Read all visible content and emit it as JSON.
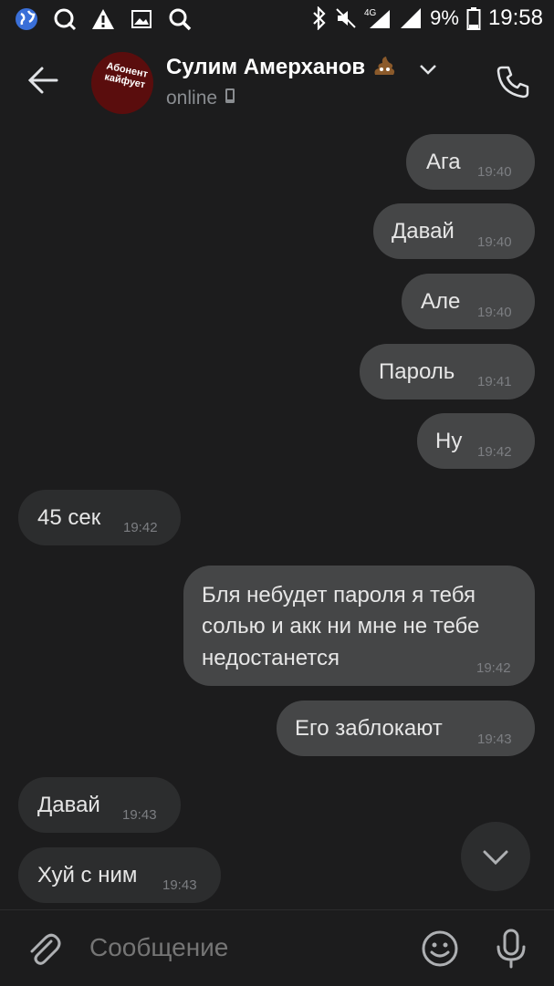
{
  "statusbar": {
    "network": "4G",
    "battery": "9%",
    "time": "19:58"
  },
  "header": {
    "contact_name": "Сулим Амерханов",
    "status": "online",
    "avatar_text": "Абонент кайфует"
  },
  "messages": [
    {
      "dir": "out",
      "text": "Ага",
      "time": "19:40"
    },
    {
      "dir": "out",
      "text": "Давай",
      "time": "19:40"
    },
    {
      "dir": "out",
      "text": "Але",
      "time": "19:40"
    },
    {
      "dir": "out",
      "text": "Пароль",
      "time": "19:41"
    },
    {
      "dir": "out",
      "text": "Ну",
      "time": "19:42"
    },
    {
      "dir": "in",
      "text": "45 сек",
      "time": "19:42"
    },
    {
      "dir": "out",
      "lines": [
        "Бля небудет пароля я тебя",
        "солью и акк ни мне не тебе",
        "недостанется"
      ],
      "time": "19:42"
    },
    {
      "dir": "out",
      "text": "Его заблокают",
      "time": "19:43"
    },
    {
      "dir": "in",
      "text": "Давай",
      "time": "19:43"
    },
    {
      "dir": "in",
      "text": "Хуй с ним",
      "time": "19:43"
    }
  ],
  "input": {
    "placeholder": "Сообщение"
  },
  "colors": {
    "background": "#1c1c1d",
    "outgoing_bubble": "#454647",
    "incoming_bubble": "#2c2d2e"
  }
}
